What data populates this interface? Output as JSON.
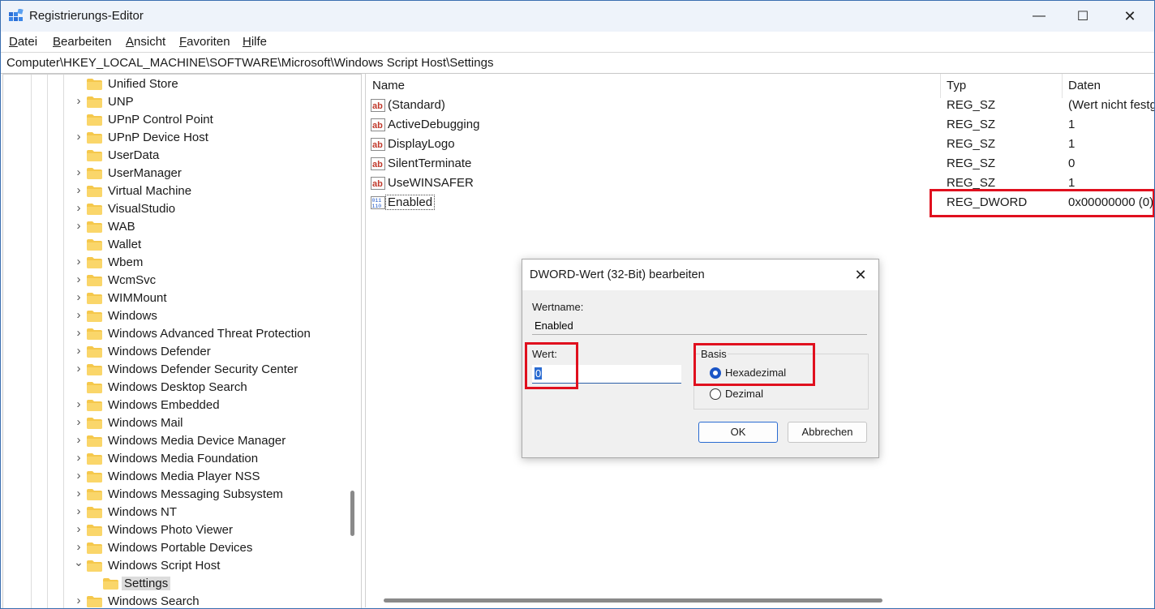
{
  "window": {
    "title": "Registrierungs-Editor",
    "minimize_glyph": "—",
    "maximize_glyph": "☐",
    "close_glyph": "✕"
  },
  "menu": [
    {
      "label": "Datei"
    },
    {
      "label": "Bearbeiten"
    },
    {
      "label": "Ansicht"
    },
    {
      "label": "Favoriten"
    },
    {
      "label": "Hilfe"
    }
  ],
  "address": "Computer\\HKEY_LOCAL_MACHINE\\SOFTWARE\\Microsoft\\Windows Script Host\\Settings",
  "tree": {
    "items": [
      {
        "label": "Unified Store",
        "expandable": false
      },
      {
        "label": "UNP",
        "expandable": true
      },
      {
        "label": "UPnP Control Point",
        "expandable": false
      },
      {
        "label": "UPnP Device Host",
        "expandable": true
      },
      {
        "label": "UserData",
        "expandable": false
      },
      {
        "label": "UserManager",
        "expandable": true
      },
      {
        "label": "Virtual Machine",
        "expandable": true
      },
      {
        "label": "VisualStudio",
        "expandable": true
      },
      {
        "label": "WAB",
        "expandable": true
      },
      {
        "label": "Wallet",
        "expandable": false
      },
      {
        "label": "Wbem",
        "expandable": true
      },
      {
        "label": "WcmSvc",
        "expandable": true
      },
      {
        "label": "WIMMount",
        "expandable": true
      },
      {
        "label": "Windows",
        "expandable": true
      },
      {
        "label": "Windows Advanced Threat Protection",
        "expandable": true
      },
      {
        "label": "Windows Defender",
        "expandable": true
      },
      {
        "label": "Windows Defender Security Center",
        "expandable": true
      },
      {
        "label": "Windows Desktop Search",
        "expandable": false
      },
      {
        "label": "Windows Embedded",
        "expandable": true
      },
      {
        "label": "Windows Mail",
        "expandable": true
      },
      {
        "label": "Windows Media Device Manager",
        "expandable": true
      },
      {
        "label": "Windows Media Foundation",
        "expandable": true
      },
      {
        "label": "Windows Media Player NSS",
        "expandable": true
      },
      {
        "label": "Windows Messaging Subsystem",
        "expandable": true
      },
      {
        "label": "Windows NT",
        "expandable": true
      },
      {
        "label": "Windows Photo Viewer",
        "expandable": true
      },
      {
        "label": "Windows Portable Devices",
        "expandable": true
      },
      {
        "label": "Windows Script Host",
        "expandable": true,
        "expanded": true
      },
      {
        "label": "Settings",
        "expandable": false,
        "child": true,
        "selected": true
      },
      {
        "label": "Windows Search",
        "expandable": true
      }
    ]
  },
  "list": {
    "columns": {
      "name": "Name",
      "type": "Typ",
      "data": "Daten"
    },
    "rows": [
      {
        "icon": "string-value-icon",
        "name": "(Standard)",
        "type": "REG_SZ",
        "data": "(Wert nicht festg"
      },
      {
        "icon": "string-value-icon",
        "name": "ActiveDebugging",
        "type": "REG_SZ",
        "data": "1"
      },
      {
        "icon": "string-value-icon",
        "name": "DisplayLogo",
        "type": "REG_SZ",
        "data": "1"
      },
      {
        "icon": "string-value-icon",
        "name": "SilentTerminate",
        "type": "REG_SZ",
        "data": "0"
      },
      {
        "icon": "string-value-icon",
        "name": "UseWINSAFER",
        "type": "REG_SZ",
        "data": "1"
      },
      {
        "icon": "binary-value-icon",
        "name": "Enabled",
        "type": "REG_DWORD",
        "data": "0x00000000 (0)",
        "focused": true
      }
    ]
  },
  "dialog": {
    "title": "DWORD-Wert (32-Bit) bearbeiten",
    "value_name_label": "Wertname:",
    "value_name": "Enabled",
    "value_label": "Wert:",
    "value": "0",
    "basis_label": "Basis",
    "hex_label": "Hexadezimal",
    "dec_label": "Dezimal",
    "hex_checked": true,
    "ok_label": "OK",
    "cancel_label": "Abbrechen"
  },
  "colors": {
    "highlight_box": "#e0101e",
    "folder": "#f5c84c",
    "accent": "#1b55c6"
  }
}
